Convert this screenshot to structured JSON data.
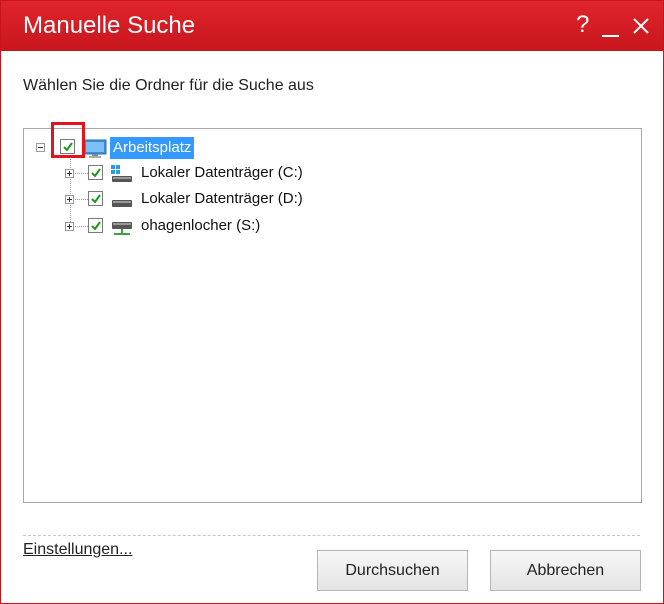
{
  "window": {
    "title": "Manuelle Suche",
    "help_label": "?",
    "close_label": "✕"
  },
  "instruction": "Wählen Sie die Ordner für die Suche aus",
  "tree": {
    "root": {
      "label": "Arbeitsplatz",
      "checked": true,
      "expanded": true,
      "selected": true,
      "icon": "computer-icon"
    },
    "children": [
      {
        "label": "Lokaler Datenträger (C:)",
        "checked": true,
        "expanded": false,
        "icon": "system-drive-icon"
      },
      {
        "label": "Lokaler Datenträger (D:)",
        "checked": true,
        "expanded": false,
        "icon": "drive-icon"
      },
      {
        "label": "ohagenlocher (S:)",
        "checked": true,
        "expanded": false,
        "icon": "network-drive-icon"
      }
    ]
  },
  "footer": {
    "settings_link": "Einstellungen...",
    "search_button": "Durchsuchen",
    "cancel_button": "Abbrechen"
  },
  "colors": {
    "titlebar": "#d81e25",
    "selection": "#3399ff",
    "highlight": "#e3151c",
    "check": "#1a9a1a"
  }
}
